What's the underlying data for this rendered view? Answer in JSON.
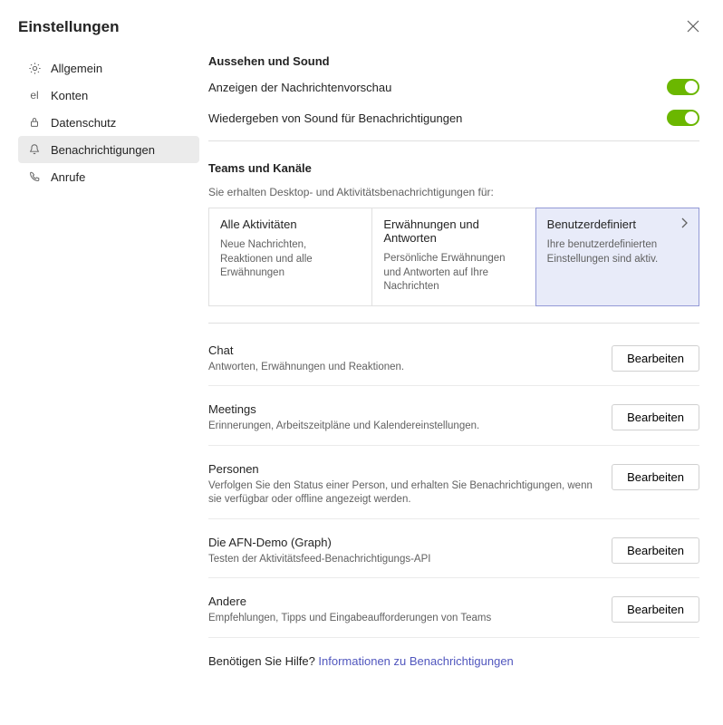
{
  "header": {
    "title": "Einstellungen"
  },
  "sidebar": {
    "items": [
      {
        "label": "Allgemein"
      },
      {
        "label": "Konten"
      },
      {
        "label": "Datenschutz"
      },
      {
        "label": "Benachrichtigungen"
      },
      {
        "label": "Anrufe"
      }
    ]
  },
  "appearance": {
    "heading": "Aussehen und Sound",
    "preview_label": "Anzeigen der Nachrichtenvorschau",
    "sound_label": "Wiedergeben von Sound für Benachrichtigungen"
  },
  "teams_channels": {
    "heading": "Teams und Kanäle",
    "sub": "Sie erhalten Desktop- und Aktivitätsbenachrichtigungen für:",
    "cards": [
      {
        "title": "Alle Aktivitäten",
        "desc": "Neue Nachrichten, Reaktionen und alle Erwähnungen"
      },
      {
        "title": "Erwähnungen und Antworten",
        "desc": "Persönliche Erwähnungen und Antworten auf Ihre Nachrichten"
      },
      {
        "title": "Benutzerdefiniert",
        "desc": "Ihre benutzerdefinierten Einstellungen sind aktiv."
      }
    ]
  },
  "categories": [
    {
      "title": "Chat",
      "desc": "Antworten, Erwähnungen und Reaktionen."
    },
    {
      "title": "Meetings",
      "desc": "Erinnerungen, Arbeitszeitpläne und Kalendereinstellungen."
    },
    {
      "title": "Personen",
      "desc": "Verfolgen Sie den Status einer Person, und erhalten Sie Benachrichtigungen, wenn sie verfügbar oder offline angezeigt werden."
    },
    {
      "title": "Die AFN-Demo (Graph)",
      "desc": "Testen der Aktivitätsfeed-Benachrichtigungs-API"
    },
    {
      "title": "Andere",
      "desc": "Empfehlungen, Tipps und Eingabeaufforderungen von Teams"
    }
  ],
  "buttons": {
    "edit": "Bearbeiten"
  },
  "help": {
    "prefix": "Benötigen Sie Hilfe? ",
    "link": "Informationen zu Benachrichtigungen"
  }
}
